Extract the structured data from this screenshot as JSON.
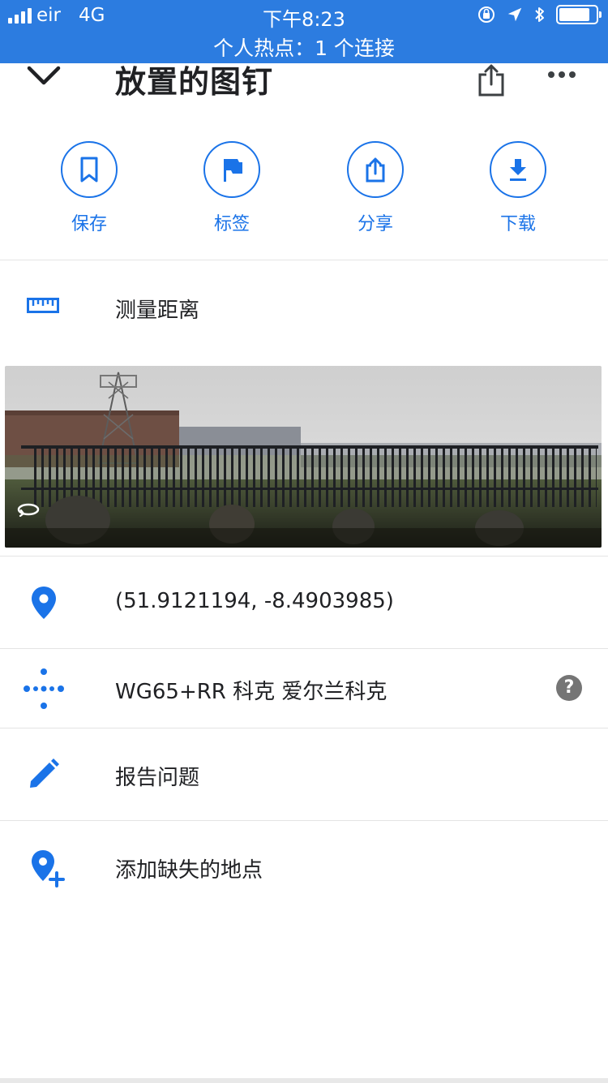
{
  "status_bar": {
    "carrier": "eir",
    "network": "4G",
    "time": "下午8:23",
    "hotspot": "个人热点：1 个连接",
    "battery_level": 0.85
  },
  "header": {
    "title": "放置的图钉",
    "back_icon": "chevron-down-icon",
    "share_icon": "share-icon",
    "more_icon": "more-icon"
  },
  "actions": [
    {
      "label": "保存",
      "icon": "bookmark-icon"
    },
    {
      "label": "标签",
      "icon": "flag-icon"
    },
    {
      "label": "分享",
      "icon": "share-icon"
    },
    {
      "label": "下载",
      "icon": "download-icon"
    }
  ],
  "measure": {
    "label": "测量距离",
    "icon": "ruler-icon"
  },
  "details": {
    "coordinates": "(51.9121194, -8.4903985)",
    "plus_code": "WG65+RR 科克 爱尔兰科克",
    "help": "?",
    "report": "报告问题",
    "add_place": "添加缺失的地点"
  },
  "colors": {
    "accent": "#1a73e8",
    "status_bar": "#2c7ce0"
  }
}
